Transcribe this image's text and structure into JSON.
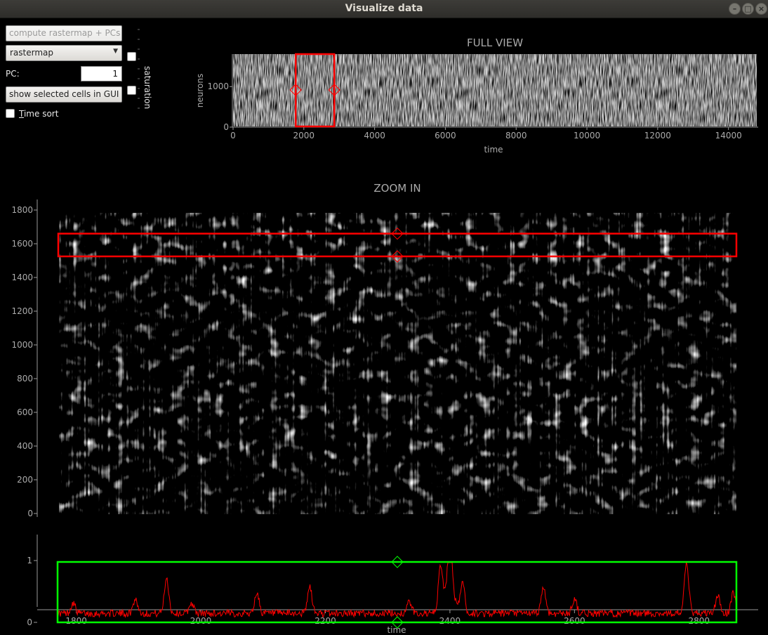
{
  "window": {
    "title": "Visualize data",
    "controls": [
      "minimize",
      "maximize",
      "close"
    ]
  },
  "controls": {
    "compute_button": "compute rastermap + PCs",
    "mode_select": "rastermap",
    "pc_label": "PC:",
    "pc_value": "1",
    "show_cells_button": "show selected cells in GUI",
    "time_sort_label": "Time sort",
    "time_sort_checked": false,
    "saturation_label": "saturation"
  },
  "full_view": {
    "title": "FULL VIEW",
    "xlabel": "time",
    "ylabel": "neurons",
    "x_ticks": [
      "0",
      "2000",
      "4000",
      "6000",
      "8000",
      "10000",
      "12000",
      "14000"
    ],
    "y_ticks": [
      "0",
      "1000"
    ],
    "xlim": [
      0,
      14800
    ],
    "ylim": [
      0,
      1800
    ],
    "selection": {
      "x_start": 1770,
      "x_end": 2860
    }
  },
  "zoom_in": {
    "title": "ZOOM IN",
    "y_ticks": [
      "0",
      "200",
      "400",
      "600",
      "800",
      "1000",
      "1200",
      "1400",
      "1600",
      "1800"
    ],
    "ylim": [
      0,
      1800
    ],
    "selection": {
      "y_start": 1525,
      "y_end": 1660
    }
  },
  "trace": {
    "xlabel": "time",
    "x_ticks": [
      "1800",
      "2000",
      "2200",
      "2400",
      "2600",
      "2800"
    ],
    "y_ticks": [
      "0",
      "1"
    ],
    "xlim": [
      1770,
      2860
    ],
    "ylim": [
      0,
      1
    ],
    "color": "#ff0000",
    "roi_color": "#00ff00"
  },
  "colors": {
    "selection": "#ff0000",
    "roi": "#00ff00",
    "axis": "#9a9a9a",
    "text": "#aaaaaa"
  }
}
